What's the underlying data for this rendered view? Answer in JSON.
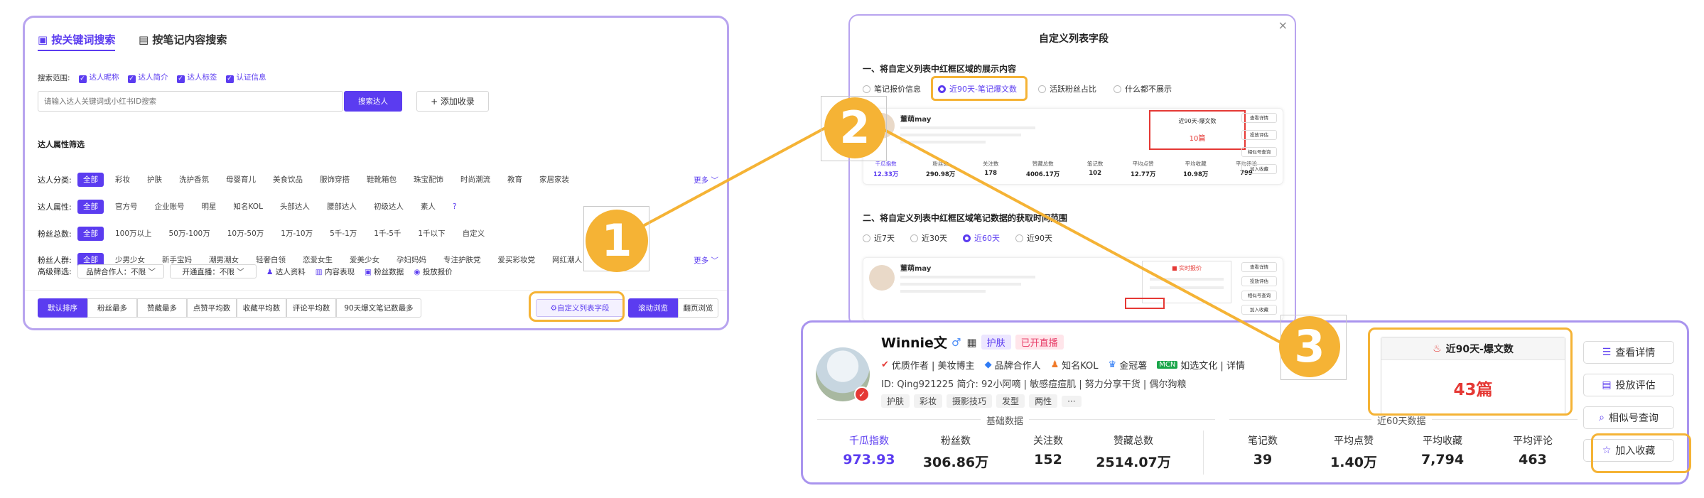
{
  "left": {
    "tab_keyword": "按关键词搜索",
    "tab_note": "按笔记内容搜索",
    "scope_label": "搜索范围:",
    "scope": [
      "达人昵称",
      "达人简介",
      "达人标签",
      "认证信息"
    ],
    "search_placeholder": "请输入达人关键词或小红书ID搜索",
    "search_btn": "搜索达人",
    "add_btn": "+ 添加收录",
    "filter_title": "达人属性筛选",
    "rows": [
      {
        "label": "达人分类:",
        "items": [
          "全部",
          "彩妆",
          "护肤",
          "洗护香氛",
          "母婴育儿",
          "美食饮品",
          "服饰穿搭",
          "鞋靴箱包",
          "珠宝配饰",
          "时尚潮流",
          "教育",
          "家居家装"
        ],
        "more": "更多 ﹀"
      },
      {
        "label": "达人属性:",
        "items": [
          "全部",
          "官方号",
          "企业账号",
          "明星",
          "知名KOL",
          "头部达人",
          "腰部达人",
          "初级达人",
          "素人",
          "?"
        ],
        "more": ""
      },
      {
        "label": "粉丝总数:",
        "items": [
          "全部",
          "100万以上",
          "50万-100万",
          "10万-50万",
          "1万-10万",
          "5千-1万",
          "1千-5千",
          "1千以下",
          "自定义"
        ],
        "more": ""
      },
      {
        "label": "粉丝人群:",
        "items": [
          "全部",
          "少男少女",
          "新手宝妈",
          "潮男潮女",
          "轻奢白领",
          "恋爱女生",
          "爱美少女",
          "孕妇妈妈",
          "专注护肤党",
          "爱买彩妆党",
          "网红潮人"
        ],
        "more": "更多 ﹀"
      }
    ],
    "advanced_label": "高级筛选:",
    "advanced": [
      "品牌合作人：不限 ﹀",
      "开通直播：不限 ﹀",
      "达人资料",
      "内容表现",
      "粉丝数据",
      "投放报价"
    ],
    "sorts": [
      "默认排序",
      "粉丝最多",
      "赞藏最多",
      "点赞平均数",
      "收藏平均数",
      "评论平均数",
      "90天爆文笔记数最多"
    ],
    "custom_btn": "自定义列表字段",
    "view_scroll": "滚动浏览",
    "view_page": "翻页浏览"
  },
  "dialog": {
    "title": "自定义列表字段",
    "close": "×",
    "section1": "一、将自定义列表中红框区域的展示内容",
    "opts1": [
      "笔记报价信息",
      "近90天-笔记爆文数",
      "活跃粉丝占比",
      "什么都不展示"
    ],
    "section2": "二、将自定义列表中红框区域笔记数据的获取时间范围",
    "opts2": [
      "近7天",
      "近30天",
      "近60天",
      "近90天"
    ],
    "mini_name": "董萌may",
    "mini_box_title": "近90天-爆文数",
    "mini_box_value": "10篇",
    "mini_stats": [
      [
        "千瓜指数",
        "12.33万"
      ],
      [
        "粉丝数",
        "290.98万"
      ],
      [
        "关注数",
        "178"
      ],
      [
        "赞藏总数",
        "4006.17万"
      ],
      [
        "笔记数",
        "102"
      ],
      [
        "平均点赞",
        "12.77万"
      ],
      [
        "平均收藏",
        "10.98万"
      ],
      [
        "平均评论",
        "799"
      ]
    ],
    "mini_btns": [
      "查看详情",
      "投放评估",
      "相似号查询",
      "加入收藏"
    ],
    "mini2_box_title": "实时报价",
    "mini2_btns": [
      "查看详情",
      "投放评估",
      "相似号查询",
      "加入收藏"
    ]
  },
  "card": {
    "name": "Winnie文",
    "tag1": "护肤",
    "tag2": "已开直播",
    "badges": "优质作者 | 美妆博主",
    "brand": "品牌合作人",
    "kol": "知名KOL",
    "crown": "金冠薯",
    "mcn": "MCN",
    "mcn_name": "如选文化 | 详情",
    "id_line": "ID: Qing921225   简介: 92小阿嘀 | 敏感痘痘肌 | 努力分享干货 | 偶尔狗粮",
    "tags": [
      "护肤",
      "彩妆",
      "摄影技巧",
      "发型",
      "两性",
      "···"
    ],
    "basic_label": "基础数据",
    "recent_label": "近60天数据",
    "box_title": "近90天-爆文数",
    "box_value": "43篇",
    "stats": [
      {
        "k": "千瓜指数",
        "v": "973.93",
        "purple": true
      },
      {
        "k": "粉丝数",
        "v": "306.86万"
      },
      {
        "k": "关注数",
        "v": "152"
      },
      {
        "k": "赞藏总数",
        "v": "2514.07万"
      },
      {
        "k": "笔记数",
        "v": "39"
      },
      {
        "k": "平均点赞",
        "v": "1.40万"
      },
      {
        "k": "平均收藏",
        "v": "7,794"
      },
      {
        "k": "平均评论",
        "v": "463"
      }
    ],
    "btns": [
      "查看详情",
      "投放评估",
      "相似号查询",
      "加入收藏"
    ]
  },
  "steps": [
    "1",
    "2",
    "3"
  ],
  "colors": {
    "accent": "#5b3cf0",
    "highlight": "#f5b335",
    "alert": "#e53935"
  }
}
